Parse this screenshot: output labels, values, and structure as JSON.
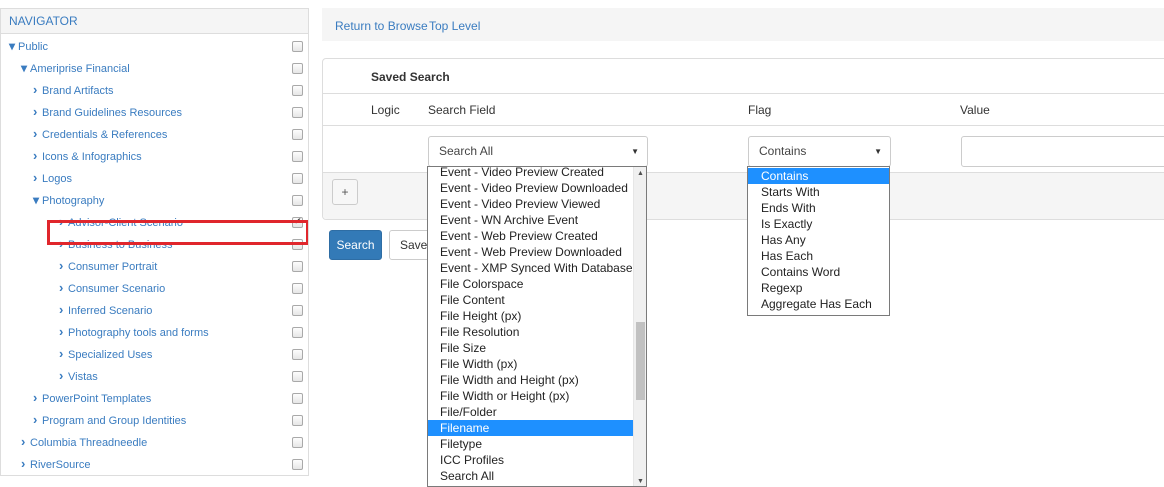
{
  "navigator": {
    "title": "NAVIGATOR",
    "items": [
      {
        "label": "Public",
        "expanded": true,
        "checked": false
      },
      {
        "label": "Ameriprise Financial",
        "expanded": true,
        "checked": false
      },
      {
        "label": "Brand Artifacts",
        "expanded": false,
        "checked": false
      },
      {
        "label": "Brand Guidelines Resources",
        "expanded": false,
        "checked": false
      },
      {
        "label": "Credentials & References",
        "expanded": false,
        "checked": false
      },
      {
        "label": "Icons & Infographics",
        "expanded": false,
        "checked": false
      },
      {
        "label": "Logos",
        "expanded": false,
        "checked": false
      },
      {
        "label": "Photography",
        "expanded": true,
        "checked": false
      },
      {
        "label": "Advisor-Client Scenario",
        "expanded": false,
        "checked": true
      },
      {
        "label": "Business to Business",
        "expanded": false,
        "checked": false
      },
      {
        "label": "Consumer Portrait",
        "expanded": false,
        "checked": false
      },
      {
        "label": "Consumer Scenario",
        "expanded": false,
        "checked": false
      },
      {
        "label": "Inferred Scenario",
        "expanded": false,
        "checked": false
      },
      {
        "label": "Photography tools and forms",
        "expanded": false,
        "checked": false
      },
      {
        "label": "Specialized Uses",
        "expanded": false,
        "checked": false
      },
      {
        "label": "Vistas",
        "expanded": false,
        "checked": false
      },
      {
        "label": "PowerPoint Templates",
        "expanded": false,
        "checked": false
      },
      {
        "label": "Program and Group Identities",
        "expanded": false,
        "checked": false
      },
      {
        "label": "Columbia Threadneedle",
        "expanded": false,
        "checked": false
      },
      {
        "label": "RiverSource",
        "expanded": false,
        "checked": false
      }
    ]
  },
  "topbar": {
    "return_link": "Return to Browse",
    "top_level_link": "Top Level"
  },
  "saved_search": {
    "title": "Saved Search",
    "columns": {
      "logic": "Logic",
      "search_field": "Search Field",
      "flag": "Flag",
      "value": "Value"
    },
    "search_field_selected": "Search All",
    "flag_selected": "Contains",
    "value": "",
    "add_button": "+",
    "search_button": "Search",
    "save_button": "Save"
  },
  "search_field_options": [
    "Event - Video Preview Created",
    "Event - Video Preview Downloaded",
    "Event - Video Preview Viewed",
    "Event - WN Archive Event",
    "Event - Web Preview Created",
    "Event - Web Preview Downloaded",
    "Event - XMP Synced With Database",
    "File Colorspace",
    "File Content",
    "File Height (px)",
    "File Resolution",
    "File Size",
    "File Width (px)",
    "File Width and Height (px)",
    "File Width or Height (px)",
    "File/Folder",
    "Filename",
    "Filetype",
    "ICC Profiles",
    "Search All"
  ],
  "search_field_highlighted": "Filename",
  "flag_options": [
    "Contains",
    "Starts With",
    "Ends With",
    "Is Exactly",
    "Has Any",
    "Has Each",
    "Contains Word",
    "Regexp",
    "Aggregate Has Each"
  ],
  "flag_highlighted": "Contains",
  "icons": {
    "expanded": "chevron-down-icon",
    "collapsed": "chevron-right-icon",
    "select_caret": "caret-down-icon"
  },
  "colors": {
    "link": "#3a7cc0",
    "primary_button": "#337ab7",
    "list_highlight": "#1e90ff",
    "selection_box": "#e0262c"
  }
}
